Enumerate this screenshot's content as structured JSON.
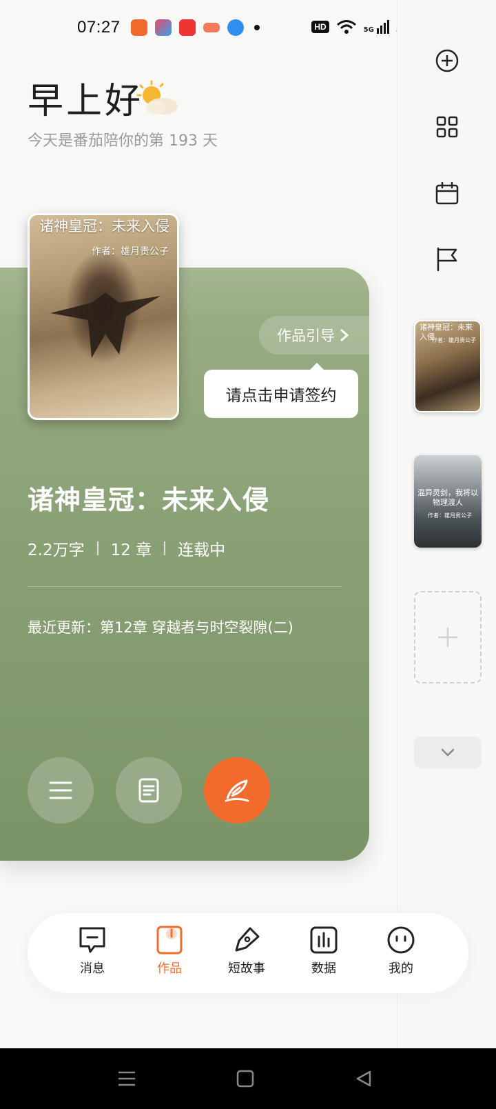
{
  "status_bar": {
    "time": "07:27",
    "hd_badge": "HD",
    "network_1": "5G",
    "network_2": "5G"
  },
  "greeting": {
    "title": "早上好",
    "subtitle": "今天是番茄陪你的第 193 天"
  },
  "book": {
    "cover_title": "诸神皇冠：未来入侵",
    "cover_author": "作者：雄月贵公子",
    "title": "诸神皇冠：未来入侵",
    "word_count": "2.2万字",
    "chapters": "12 章",
    "status": "连载中",
    "last_update": "最近更新：第12章 穿越者与时空裂隙(二)",
    "guide_label": "作品引导",
    "tooltip": "请点击申请签约"
  },
  "sidebar": {
    "cover_1_title": "诸神皇冠：未来入侵",
    "cover_1_author": "作者：雄月贵公子",
    "cover_2_title": "混异灵剑，我将以物理渡人",
    "cover_2_author": "作者：雄月贵公子"
  },
  "bottom_nav": {
    "items": [
      {
        "label": "消息"
      },
      {
        "label": "作品"
      },
      {
        "label": "短故事"
      },
      {
        "label": "数据"
      },
      {
        "label": "我的"
      }
    ],
    "active_index": 1
  },
  "colors": {
    "accent": "#f26b2d",
    "card_green": "#8aa177"
  }
}
